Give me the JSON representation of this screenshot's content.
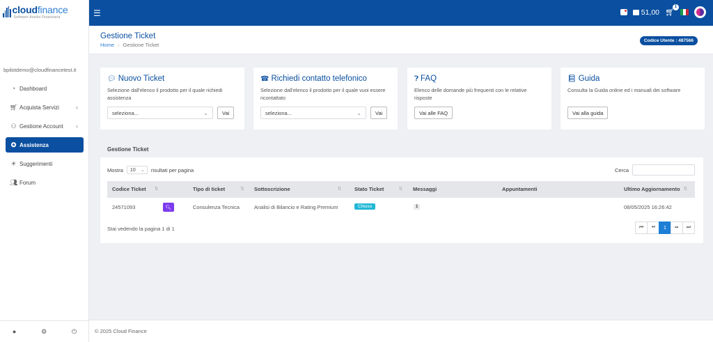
{
  "brand": {
    "name_bold": "cloud",
    "name_light": "finance",
    "subtitle": "Software Analisi Finanziaria"
  },
  "sidebar": {
    "user_email": "bpilotdemo@cloudfinancetest.it",
    "items": [
      {
        "label": "Dashboard",
        "icon": "dashboard-icon"
      },
      {
        "label": "Acquista Servizi",
        "icon": "cart-icon"
      },
      {
        "label": "Gestione Account",
        "icon": "user-icon"
      },
      {
        "label": "Assistenza",
        "icon": "support-icon"
      },
      {
        "label": "Suggerimenti",
        "icon": "bulb-icon"
      },
      {
        "label": "Forum",
        "icon": "users-icon"
      }
    ]
  },
  "topbar": {
    "credit": "51,00",
    "cart_count": "1",
    "colors": {
      "primary": "#0a4fa0"
    }
  },
  "header": {
    "title": "Gestione Ticket",
    "breadcrumb_home": "Home",
    "breadcrumb_current": "Gestione Ticket",
    "user_code": "Codice Utente : 487566"
  },
  "cards": {
    "new_ticket": {
      "title": "Nuovo Ticket",
      "desc": "Selezione dall'elenco il prodotto per il quale richiedi assistenza",
      "select_value": "seleziona...",
      "button": "Vai"
    },
    "phone": {
      "title": "Richiedi contatto telefonico",
      "desc": "Selezione dall'elenco il prodotto per il quale vuoi essere ricontattato",
      "select_value": "seleziona...",
      "button": "Vai"
    },
    "faq": {
      "title": "FAQ",
      "desc": "Elenco delle domande più frequenti con le relative risposte",
      "button": "Vai alle FAQ"
    },
    "guide": {
      "title": "Guida",
      "desc": "Consulta la Guida online ed i manuali dei software",
      "button": "Vai alla guida"
    }
  },
  "tickets": {
    "section_title": "Gestione Ticket",
    "show_label": "Mostra",
    "page_length": "10",
    "per_page_label": "risultati per pagina",
    "search_label": "Cerca",
    "columns": [
      "Codice Ticket",
      "Tipo di ticket",
      "Sottoscrizione",
      "Stato Ticket",
      "Messaggi",
      "Appuntamenti",
      "Ultimo Aggiornamento"
    ],
    "rows": [
      {
        "code": "24571093",
        "type": "Consulenza Tecnica",
        "subscription": "Analisi di Bilancio e Rating Premium",
        "status": "Chiuso",
        "messages": "1",
        "appointments": "",
        "updated": "08/05/2025 16:26:42"
      }
    ],
    "page_info": "Stai vedendo la pagina 1 di 1",
    "current_page": "1"
  },
  "footer": {
    "text": "© 2025 Cloud Finance"
  }
}
